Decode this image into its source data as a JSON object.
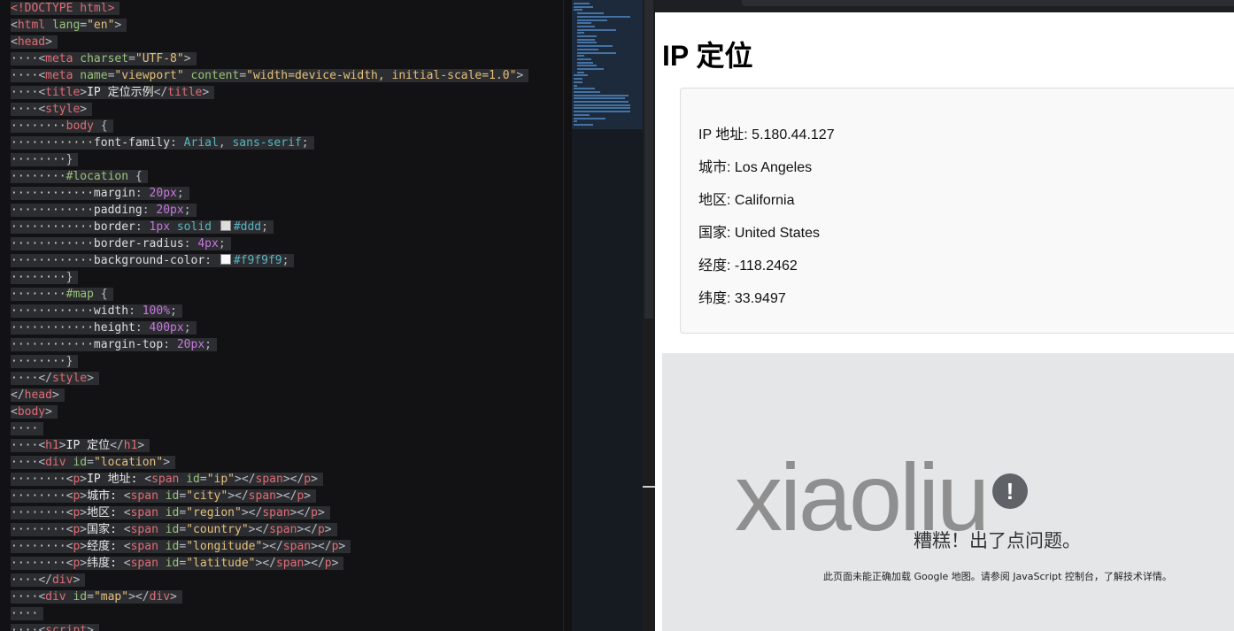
{
  "editor": {
    "lines": [
      [
        {
          "t": "<!DOCTYPE ",
          "c": "tag"
        },
        {
          "t": "html",
          "c": "tag"
        },
        {
          "t": ">",
          "c": "tag"
        }
      ],
      [
        {
          "t": "<",
          "c": "br"
        },
        {
          "t": "html",
          "c": "tag"
        },
        {
          "t": " lang",
          "c": "attr"
        },
        {
          "t": "=",
          "c": "punc"
        },
        {
          "t": "\"en\"",
          "c": "str"
        },
        {
          "t": ">",
          "c": "br"
        }
      ],
      [
        {
          "t": "<",
          "c": "br"
        },
        {
          "t": "head",
          "c": "tag"
        },
        {
          "t": ">",
          "c": "br"
        }
      ],
      [
        {
          "t": "    ",
          "c": "ws"
        },
        {
          "t": "<",
          "c": "br"
        },
        {
          "t": "meta",
          "c": "tag"
        },
        {
          "t": " charset",
          "c": "attr"
        },
        {
          "t": "=",
          "c": "punc"
        },
        {
          "t": "\"UTF-8\"",
          "c": "str"
        },
        {
          "t": ">",
          "c": "br"
        }
      ],
      [
        {
          "t": "    ",
          "c": "ws"
        },
        {
          "t": "<",
          "c": "br"
        },
        {
          "t": "meta",
          "c": "tag"
        },
        {
          "t": " name",
          "c": "attr"
        },
        {
          "t": "=",
          "c": "punc"
        },
        {
          "t": "\"viewport\"",
          "c": "str"
        },
        {
          "t": " content",
          "c": "attr"
        },
        {
          "t": "=",
          "c": "punc"
        },
        {
          "t": "\"width=device-width, initial-scale=1.0\"",
          "c": "str"
        },
        {
          "t": ">",
          "c": "br"
        }
      ],
      [
        {
          "t": "    ",
          "c": "ws"
        },
        {
          "t": "<",
          "c": "br"
        },
        {
          "t": "title",
          "c": "tag"
        },
        {
          "t": ">",
          "c": "br"
        },
        {
          "t": "IP 定位示例",
          "c": "txt"
        },
        {
          "t": "</",
          "c": "br"
        },
        {
          "t": "title",
          "c": "tag"
        },
        {
          "t": ">",
          "c": "br"
        }
      ],
      [
        {
          "t": "    ",
          "c": "ws"
        },
        {
          "t": "<",
          "c": "br"
        },
        {
          "t": "style",
          "c": "tag"
        },
        {
          "t": ">",
          "c": "br"
        }
      ],
      [
        {
          "t": "        ",
          "c": "ws"
        },
        {
          "t": "body",
          "c": "sel"
        },
        {
          "t": " {",
          "c": "punc"
        }
      ],
      [
        {
          "t": "            ",
          "c": "ws"
        },
        {
          "t": "font-family",
          "c": "prop"
        },
        {
          "t": ": ",
          "c": "punc"
        },
        {
          "t": "Arial",
          "c": "kw"
        },
        {
          "t": ", ",
          "c": "punc"
        },
        {
          "t": "sans-serif",
          "c": "kw"
        },
        {
          "t": ";",
          "c": "punc"
        }
      ],
      [
        {
          "t": "        ",
          "c": "ws"
        },
        {
          "t": "}",
          "c": "punc"
        }
      ],
      [
        {
          "t": "        ",
          "c": "ws"
        },
        {
          "t": "#location",
          "c": "id"
        },
        {
          "t": " {",
          "c": "punc"
        }
      ],
      [
        {
          "t": "            ",
          "c": "ws"
        },
        {
          "t": "margin",
          "c": "prop"
        },
        {
          "t": ": ",
          "c": "punc"
        },
        {
          "t": "20px",
          "c": "num"
        },
        {
          "t": ";",
          "c": "punc"
        }
      ],
      [
        {
          "t": "            ",
          "c": "ws"
        },
        {
          "t": "padding",
          "c": "prop"
        },
        {
          "t": ": ",
          "c": "punc"
        },
        {
          "t": "20px",
          "c": "num"
        },
        {
          "t": ";",
          "c": "punc"
        }
      ],
      [
        {
          "t": "            ",
          "c": "ws"
        },
        {
          "t": "border",
          "c": "prop"
        },
        {
          "t": ": ",
          "c": "punc"
        },
        {
          "t": "1px",
          "c": "num"
        },
        {
          "t": " solid ",
          "c": "kw"
        },
        {
          "sw": "#dddddd"
        },
        {
          "t": "#ddd",
          "c": "kw"
        },
        {
          "t": ";",
          "c": "punc"
        }
      ],
      [
        {
          "t": "            ",
          "c": "ws"
        },
        {
          "t": "border-radius",
          "c": "prop"
        },
        {
          "t": ": ",
          "c": "punc"
        },
        {
          "t": "4px",
          "c": "num"
        },
        {
          "t": ";",
          "c": "punc"
        }
      ],
      [
        {
          "t": "            ",
          "c": "ws"
        },
        {
          "t": "background-color",
          "c": "prop"
        },
        {
          "t": ": ",
          "c": "punc"
        },
        {
          "sw": "#f9f9f9"
        },
        {
          "t": "#f9f9f9",
          "c": "kw"
        },
        {
          "t": ";",
          "c": "punc"
        }
      ],
      [
        {
          "t": "        ",
          "c": "ws"
        },
        {
          "t": "}",
          "c": "punc"
        }
      ],
      [
        {
          "t": "        ",
          "c": "ws"
        },
        {
          "t": "#map",
          "c": "id"
        },
        {
          "t": " {",
          "c": "punc"
        }
      ],
      [
        {
          "t": "            ",
          "c": "ws"
        },
        {
          "t": "width",
          "c": "prop"
        },
        {
          "t": ": ",
          "c": "punc"
        },
        {
          "t": "100%",
          "c": "num"
        },
        {
          "t": ";",
          "c": "punc"
        }
      ],
      [
        {
          "t": "            ",
          "c": "ws"
        },
        {
          "t": "height",
          "c": "prop"
        },
        {
          "t": ": ",
          "c": "punc"
        },
        {
          "t": "400px",
          "c": "num"
        },
        {
          "t": ";",
          "c": "punc"
        }
      ],
      [
        {
          "t": "            ",
          "c": "ws"
        },
        {
          "t": "margin-top",
          "c": "prop"
        },
        {
          "t": ": ",
          "c": "punc"
        },
        {
          "t": "20px",
          "c": "num"
        },
        {
          "t": ";",
          "c": "punc"
        }
      ],
      [
        {
          "t": "        ",
          "c": "ws"
        },
        {
          "t": "}",
          "c": "punc"
        }
      ],
      [
        {
          "t": "    ",
          "c": "ws"
        },
        {
          "t": "</",
          "c": "br"
        },
        {
          "t": "style",
          "c": "tag"
        },
        {
          "t": ">",
          "c": "br"
        }
      ],
      [
        {
          "t": "</",
          "c": "br"
        },
        {
          "t": "head",
          "c": "tag"
        },
        {
          "t": ">",
          "c": "br"
        }
      ],
      [
        {
          "t": "<",
          "c": "br"
        },
        {
          "t": "body",
          "c": "tag"
        },
        {
          "t": ">",
          "c": "br"
        }
      ],
      [
        {
          "t": "    ",
          "c": "ws"
        }
      ],
      [
        {
          "t": "    ",
          "c": "ws"
        },
        {
          "t": "<",
          "c": "br"
        },
        {
          "t": "h1",
          "c": "tag"
        },
        {
          "t": ">",
          "c": "br"
        },
        {
          "t": "IP 定位",
          "c": "txt"
        },
        {
          "t": "</",
          "c": "br"
        },
        {
          "t": "h1",
          "c": "tag"
        },
        {
          "t": ">",
          "c": "br"
        }
      ],
      [
        {
          "t": "    ",
          "c": "ws"
        },
        {
          "t": "<",
          "c": "br"
        },
        {
          "t": "div",
          "c": "tag"
        },
        {
          "t": " id",
          "c": "attr"
        },
        {
          "t": "=",
          "c": "punc"
        },
        {
          "t": "\"location\"",
          "c": "str"
        },
        {
          "t": ">",
          "c": "br"
        }
      ],
      [
        {
          "t": "        ",
          "c": "ws"
        },
        {
          "t": "<",
          "c": "br"
        },
        {
          "t": "p",
          "c": "tag"
        },
        {
          "t": ">",
          "c": "br"
        },
        {
          "t": "IP 地址: ",
          "c": "txt"
        },
        {
          "t": "<",
          "c": "br"
        },
        {
          "t": "span",
          "c": "tag"
        },
        {
          "t": " id",
          "c": "attr"
        },
        {
          "t": "=",
          "c": "punc"
        },
        {
          "t": "\"ip\"",
          "c": "str"
        },
        {
          "t": "></",
          "c": "br"
        },
        {
          "t": "span",
          "c": "tag"
        },
        {
          "t": "></",
          "c": "br"
        },
        {
          "t": "p",
          "c": "tag"
        },
        {
          "t": ">",
          "c": "br"
        }
      ],
      [
        {
          "t": "        ",
          "c": "ws"
        },
        {
          "t": "<",
          "c": "br"
        },
        {
          "t": "p",
          "c": "tag"
        },
        {
          "t": ">",
          "c": "br"
        },
        {
          "t": "城市: ",
          "c": "txt"
        },
        {
          "t": "<",
          "c": "br"
        },
        {
          "t": "span",
          "c": "tag"
        },
        {
          "t": " id",
          "c": "attr"
        },
        {
          "t": "=",
          "c": "punc"
        },
        {
          "t": "\"city\"",
          "c": "str"
        },
        {
          "t": "></",
          "c": "br"
        },
        {
          "t": "span",
          "c": "tag"
        },
        {
          "t": "></",
          "c": "br"
        },
        {
          "t": "p",
          "c": "tag"
        },
        {
          "t": ">",
          "c": "br"
        }
      ],
      [
        {
          "t": "        ",
          "c": "ws"
        },
        {
          "t": "<",
          "c": "br"
        },
        {
          "t": "p",
          "c": "tag"
        },
        {
          "t": ">",
          "c": "br"
        },
        {
          "t": "地区: ",
          "c": "txt"
        },
        {
          "t": "<",
          "c": "br"
        },
        {
          "t": "span",
          "c": "tag"
        },
        {
          "t": " id",
          "c": "attr"
        },
        {
          "t": "=",
          "c": "punc"
        },
        {
          "t": "\"region\"",
          "c": "str"
        },
        {
          "t": "></",
          "c": "br"
        },
        {
          "t": "span",
          "c": "tag"
        },
        {
          "t": "></",
          "c": "br"
        },
        {
          "t": "p",
          "c": "tag"
        },
        {
          "t": ">",
          "c": "br"
        }
      ],
      [
        {
          "t": "        ",
          "c": "ws"
        },
        {
          "t": "<",
          "c": "br"
        },
        {
          "t": "p",
          "c": "tag"
        },
        {
          "t": ">",
          "c": "br"
        },
        {
          "t": "国家: ",
          "c": "txt"
        },
        {
          "t": "<",
          "c": "br"
        },
        {
          "t": "span",
          "c": "tag"
        },
        {
          "t": " id",
          "c": "attr"
        },
        {
          "t": "=",
          "c": "punc"
        },
        {
          "t": "\"country\"",
          "c": "str"
        },
        {
          "t": "></",
          "c": "br"
        },
        {
          "t": "span",
          "c": "tag"
        },
        {
          "t": "></",
          "c": "br"
        },
        {
          "t": "p",
          "c": "tag"
        },
        {
          "t": ">",
          "c": "br"
        }
      ],
      [
        {
          "t": "        ",
          "c": "ws"
        },
        {
          "t": "<",
          "c": "br"
        },
        {
          "t": "p",
          "c": "tag"
        },
        {
          "t": ">",
          "c": "br"
        },
        {
          "t": "经度: ",
          "c": "txt"
        },
        {
          "t": "<",
          "c": "br"
        },
        {
          "t": "span",
          "c": "tag"
        },
        {
          "t": " id",
          "c": "attr"
        },
        {
          "t": "=",
          "c": "punc"
        },
        {
          "t": "\"longitude\"",
          "c": "str"
        },
        {
          "t": "></",
          "c": "br"
        },
        {
          "t": "span",
          "c": "tag"
        },
        {
          "t": "></",
          "c": "br"
        },
        {
          "t": "p",
          "c": "tag"
        },
        {
          "t": ">",
          "c": "br"
        }
      ],
      [
        {
          "t": "        ",
          "c": "ws"
        },
        {
          "t": "<",
          "c": "br"
        },
        {
          "t": "p",
          "c": "tag"
        },
        {
          "t": ">",
          "c": "br"
        },
        {
          "t": "纬度: ",
          "c": "txt"
        },
        {
          "t": "<",
          "c": "br"
        },
        {
          "t": "span",
          "c": "tag"
        },
        {
          "t": " id",
          "c": "attr"
        },
        {
          "t": "=",
          "c": "punc"
        },
        {
          "t": "\"latitude\"",
          "c": "str"
        },
        {
          "t": "></",
          "c": "br"
        },
        {
          "t": "span",
          "c": "tag"
        },
        {
          "t": "></",
          "c": "br"
        },
        {
          "t": "p",
          "c": "tag"
        },
        {
          "t": ">",
          "c": "br"
        }
      ],
      [
        {
          "t": "    ",
          "c": "ws"
        },
        {
          "t": "</",
          "c": "br"
        },
        {
          "t": "div",
          "c": "tag"
        },
        {
          "t": ">",
          "c": "br"
        }
      ],
      [
        {
          "t": "    ",
          "c": "ws"
        },
        {
          "t": "<",
          "c": "br"
        },
        {
          "t": "div",
          "c": "tag"
        },
        {
          "t": " id",
          "c": "attr"
        },
        {
          "t": "=",
          "c": "punc"
        },
        {
          "t": "\"map\"",
          "c": "str"
        },
        {
          "t": "></",
          "c": "br"
        },
        {
          "t": "div",
          "c": "tag"
        },
        {
          "t": ">",
          "c": "br"
        }
      ],
      [
        {
          "t": "    ",
          "c": "ws"
        }
      ],
      [
        {
          "t": "    ",
          "c": "ws"
        },
        {
          "t": "<",
          "c": "br"
        },
        {
          "t": "script",
          "c": "tag"
        },
        {
          "t": ">",
          "c": "br"
        }
      ]
    ]
  },
  "preview": {
    "title": "IP 定位",
    "location": {
      "ip_label": "IP 地址: ",
      "ip": "5.180.44.127",
      "city_label": "城市: ",
      "city": "Los Angeles",
      "region_label": "地区: ",
      "region": "California",
      "country_label": "国家: ",
      "country": "United States",
      "longitude_label": "经度: ",
      "longitude": "-118.2462",
      "latitude_label": "纬度: ",
      "latitude": "33.9497"
    },
    "map": {
      "error_icon": "!",
      "error_title": "糟糕！出了点问题。",
      "error_desc": "此页面未能正确加载 Google 地图。请参阅 JavaScript 控制台，了解技术详情。"
    },
    "watermark": "xiaoliu"
  },
  "colors": {
    "editor_bg": "#121214",
    "preview_bg": "#ffffff",
    "location_bg": "#f9f9f9",
    "location_border": "#dddddd",
    "map_bg": "#e5e6e8"
  }
}
